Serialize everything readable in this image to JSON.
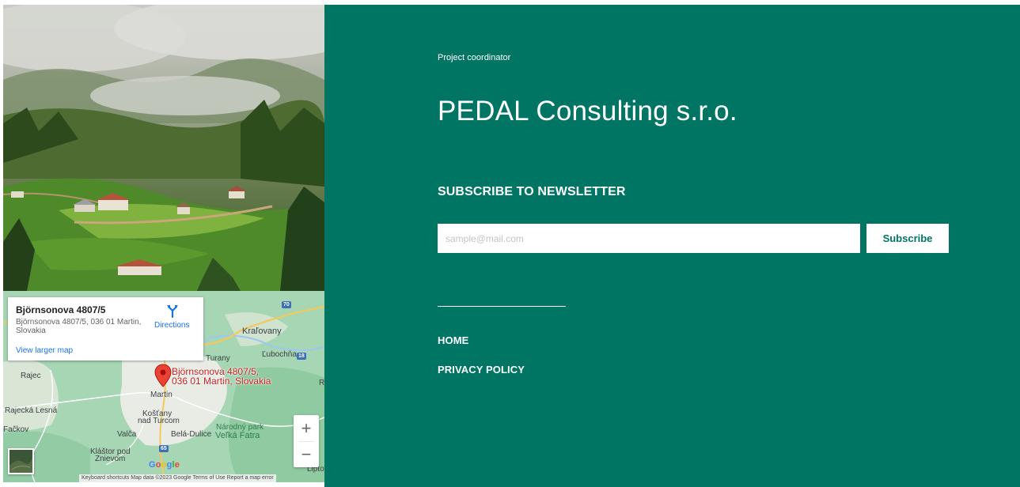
{
  "colors": {
    "brand_green": "#007563",
    "white": "#ffffff",
    "map_link_blue": "#1a73e8",
    "pin_red": "#ea4335"
  },
  "photo": {
    "icon": "landscape-photo"
  },
  "map": {
    "card": {
      "title": "Björnsonova 4807/5",
      "address": "Björnsonova 4807/5, 036 01 Martin, Slovakia",
      "directions_label": "Directions",
      "larger_map_label": "View larger map"
    },
    "pin_label_line1": "Björnsonova 4807/5,",
    "pin_label_line2": "036 01 Martin, Slovakia",
    "places": {
      "kralovany": "Kraľovany",
      "turany": "Turany",
      "lubochna": "Ľubochňa",
      "rajec": "Rajec",
      "martin": "Martin",
      "rajecka_lesna": "Rajecká Lesná",
      "kostany_1": "Košťany",
      "kostany_2": "nad Turcom",
      "fackov": "Fačkov",
      "valca": "Valča",
      "bela_dulice": "Belá-Dulice",
      "park_1": "Národný park",
      "park_2": "Veľká Fatra",
      "klastor_1": "Kláštor pod",
      "klastor_2": "Znievom",
      "liptov": "Liptov",
      "r_edge": "R"
    },
    "shields": {
      "road_70": "70",
      "road_18": "18",
      "road_65": "65"
    },
    "zoom_in": "+",
    "zoom_out": "−",
    "google": [
      "G",
      "o",
      "o",
      "g",
      "l",
      "e"
    ],
    "footer": "Keyboard shortcuts  Map data ©2023 Google  Terms of Use  Report a map error"
  },
  "content": {
    "kicker": "Project coordinator",
    "company": "PEDAL Consulting s.r.o.",
    "newsletter_heading": "SUBSCRIBE TO NEWSLETTER",
    "email_placeholder": "sample@mail.com",
    "email_value": "",
    "subscribe_label": "Subscribe",
    "nav": {
      "home": "HOME",
      "privacy": "PRIVACY POLICY"
    }
  }
}
